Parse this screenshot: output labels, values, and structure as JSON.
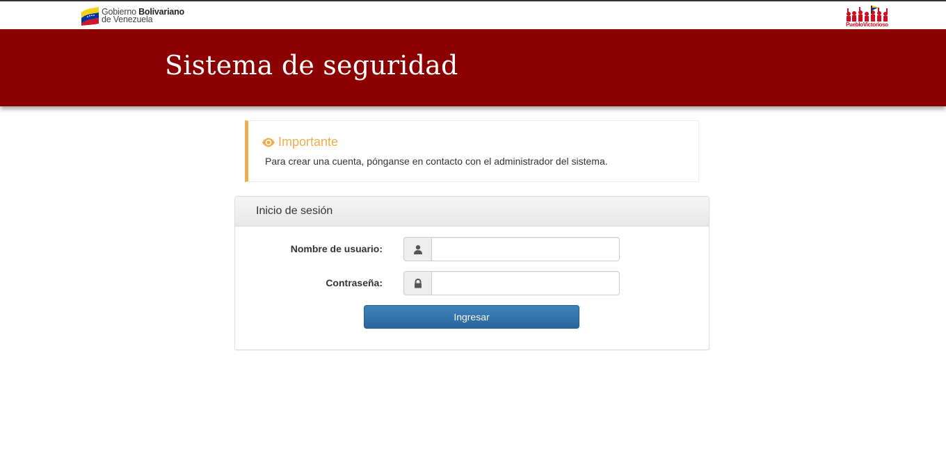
{
  "gov_logo": {
    "line1_prefix": "Gobierno ",
    "line1_bold": "Bolivariano",
    "line2": "de Venezuela"
  },
  "pueblo_logo": {
    "text": "PuebloVictorioso"
  },
  "header": {
    "title": "Sistema de seguridad",
    "background_color": "#8b0000"
  },
  "alert": {
    "icon": "eye-icon",
    "title": "Importante",
    "message": "Para crear una cuenta, pónganse en contacto con el administrador del sistema.",
    "accent_color": "#f0ad4e"
  },
  "login": {
    "panel_title": "Inicio de sesión",
    "username_label": "Nombre de usuario:",
    "username_value": "",
    "username_icon": "user-icon",
    "password_label": "Contraseña:",
    "password_value": "",
    "password_icon": "lock-icon",
    "submit_label": "Ingresar",
    "button_color": "#2e6da4"
  }
}
